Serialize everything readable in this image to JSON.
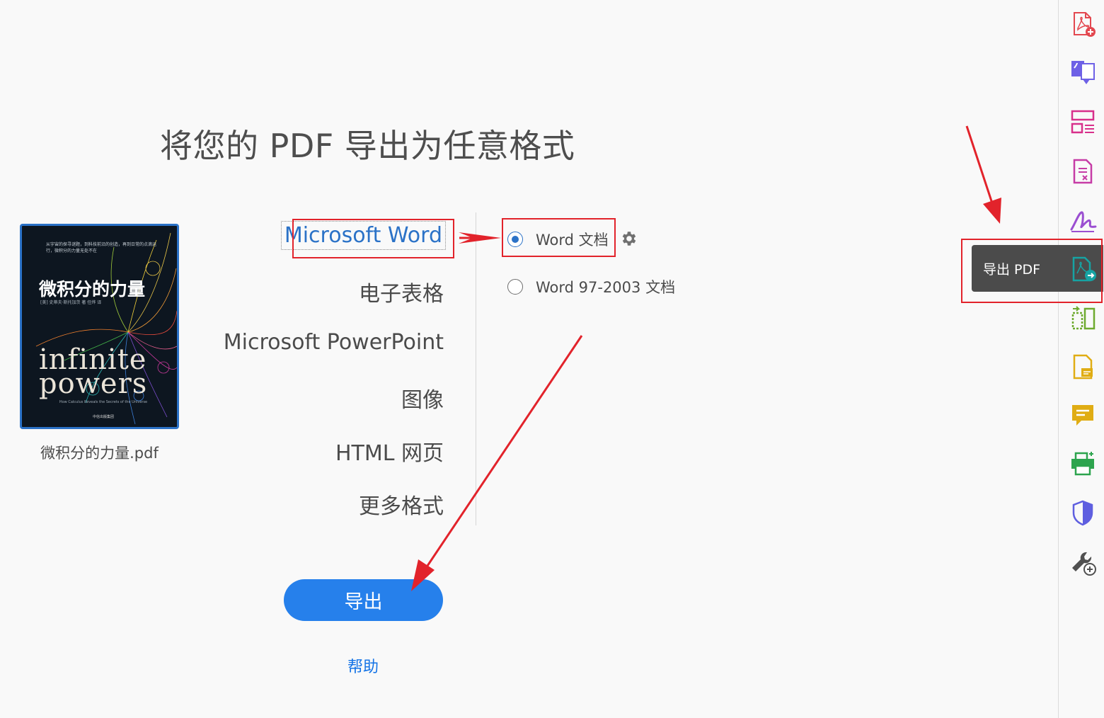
{
  "title": "将您的 PDF 导出为任意格式",
  "file": {
    "name": "微积分的力量.pdf",
    "cover": {
      "tagline": "从宇宙的探寻谜题，到科技前沿的创造，再到日常的点滴运行，微积分的力量无处不在",
      "title_cn": "微积分的力量",
      "author": "[美] 史蒂夫·斯托加茨 著  任烨 译",
      "title_en_1": "infinite",
      "title_en_2": "powers",
      "subtitle_en": "How Calculus Reveals the Secrets of the Universe",
      "publisher": "中信出版集团"
    }
  },
  "formats": [
    {
      "label": "Microsoft Word",
      "selected": true
    },
    {
      "label": "电子表格",
      "selected": false
    },
    {
      "label": "Microsoft PowerPoint",
      "selected": false
    },
    {
      "label": "图像",
      "selected": false
    },
    {
      "label": "HTML 网页",
      "selected": false
    },
    {
      "label": "更多格式",
      "selected": false
    }
  ],
  "word_options": [
    {
      "label": "Word 文档",
      "checked": true
    },
    {
      "label": "Word 97-2003 文档",
      "checked": false
    }
  ],
  "settings_icon": "gear-icon",
  "export_button": "导出",
  "help_link": "帮助",
  "toolbar": {
    "tooltip": "导出 PDF",
    "tools": [
      {
        "icon": "create-pdf-icon",
        "color": "#e34850"
      },
      {
        "icon": "combine-files-icon",
        "color": "#6e61e6"
      },
      {
        "icon": "organize-pages-icon",
        "color": "#d8308b"
      },
      {
        "icon": "edit-pdf-icon",
        "color": "#c63ca6"
      },
      {
        "icon": "fill-sign-icon",
        "color": "#9b4fd1"
      },
      {
        "icon": "export-pdf-icon",
        "color": "#16a3a3"
      },
      {
        "icon": "compare-files-icon",
        "color": "#6eaa2f"
      },
      {
        "icon": "comment-file-icon",
        "color": "#e0ad14"
      },
      {
        "icon": "comment-icon",
        "color": "#e0ad14"
      },
      {
        "icon": "print-production-icon",
        "color": "#2da44e"
      },
      {
        "icon": "protect-icon",
        "color": "#5f5fe0"
      },
      {
        "icon": "more-tools-icon",
        "color": "#505050"
      }
    ]
  },
  "accent_color": "#2680eb",
  "annotation_color": "#e2232b"
}
